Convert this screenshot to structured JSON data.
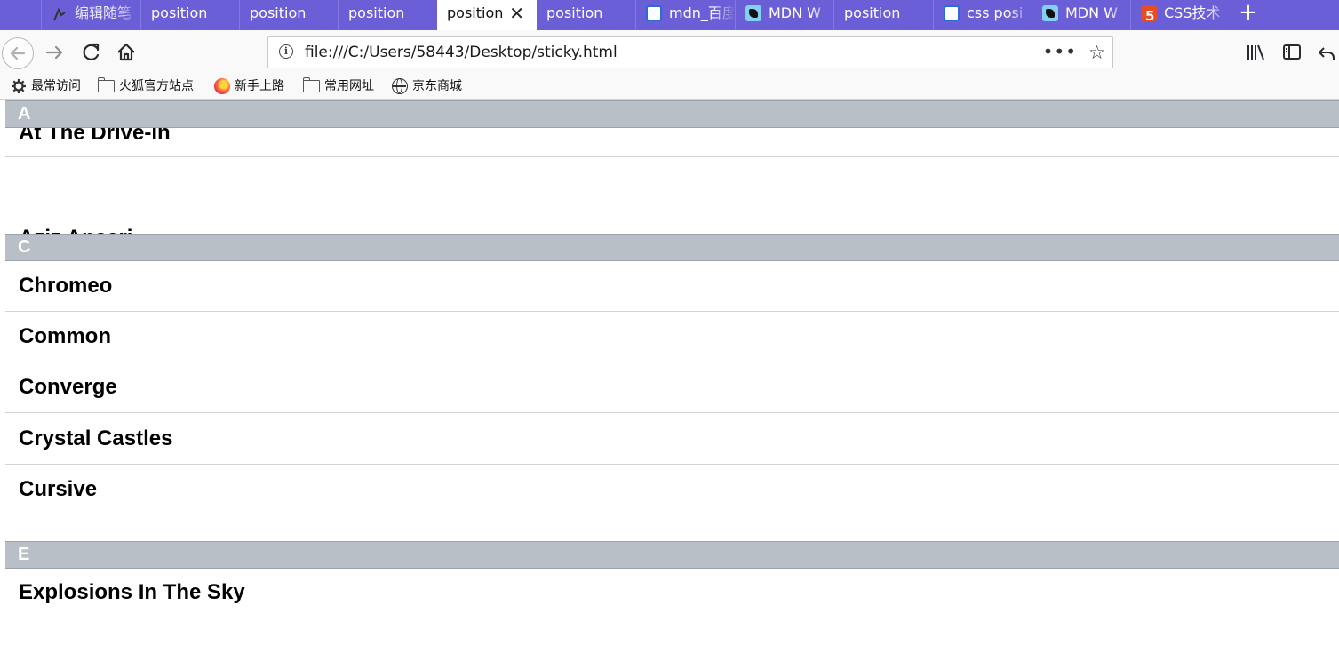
{
  "browser": {
    "tabs": [
      {
        "label": "编辑随笔",
        "favicon": "cnblogs-icon"
      },
      {
        "label": "position",
        "favicon": ""
      },
      {
        "label": "position",
        "favicon": ""
      },
      {
        "label": "position",
        "favicon": ""
      },
      {
        "label": "position",
        "favicon": "",
        "active": true
      },
      {
        "label": "position",
        "favicon": ""
      },
      {
        "label": "mdn_百度",
        "favicon": "baidu-icon"
      },
      {
        "label": "MDN W",
        "favicon": "mdn-icon"
      },
      {
        "label": "position",
        "favicon": ""
      },
      {
        "label": "css posi",
        "favicon": "baidu-icon"
      },
      {
        "label": "MDN W",
        "favicon": "mdn-icon"
      },
      {
        "label": "CSS技术",
        "favicon": "css5-icon"
      }
    ],
    "url": "file:///C:/Users/58443/Desktop/sticky.html",
    "page_actions_glyph": "•••",
    "bookmarks": [
      {
        "label": "最常访问",
        "icon": "gear-icon"
      },
      {
        "label": "火狐官方站点",
        "icon": "folder-icon"
      },
      {
        "label": "新手上路",
        "icon": "firefox-icon"
      },
      {
        "label": "常用网址",
        "icon": "folder-icon"
      },
      {
        "label": "京东商城",
        "icon": "globe-icon"
      }
    ],
    "colors": {
      "tabstrip": "#6a5fd6",
      "toolbar": "#f9f9fa"
    }
  },
  "page": {
    "sections": [
      {
        "letter": "A",
        "items": [
          "At The Drive-In",
          "Aziz Ansari"
        ]
      },
      {
        "letter": "C",
        "items": [
          "Chromeo",
          "Common",
          "Converge",
          "Crystal Castles",
          "Cursive"
        ]
      },
      {
        "letter": "E",
        "items": [
          "Explosions In The Sky"
        ]
      }
    ],
    "colors": {
      "section_header_bg": "#b8bfc6",
      "section_header_text": "#ffffff",
      "divider": "#d3d3d3"
    }
  }
}
